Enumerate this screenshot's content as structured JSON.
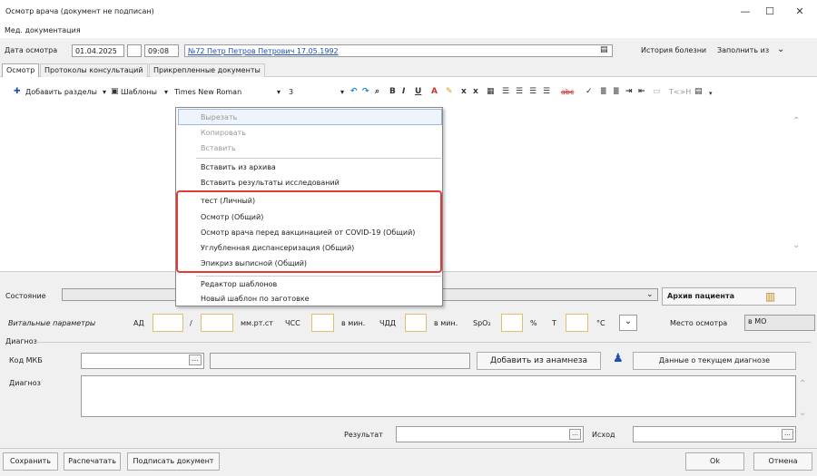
{
  "window": {
    "title": "Осмотр врача (документ не подписан)",
    "min": "—",
    "max": "☐",
    "close": "✕"
  },
  "menu_label": "Мед. документация",
  "header": {
    "date_label": "Дата осмотра",
    "date": "01.04.2025",
    "time": "09:08",
    "patient_link": "№72 Петр Петров Петрович 17.05.1992",
    "history_btn": "История болезни",
    "fill_from": "Заполнить из",
    "fill_arrow": "⌄"
  },
  "tabs": [
    "Осмотр",
    "Протоколы консультаций",
    "Прикрепленные документы"
  ],
  "toolbar": {
    "add_sections": "Добавить разделы",
    "templates": "Шаблоны",
    "font": "Times New Roman",
    "size": "3",
    "dropdown": "▾",
    "bold": "B",
    "italic": "I",
    "underline": "U",
    "sub": "x",
    "sup": "x",
    "strike": "abc",
    "tag": "T<>H"
  },
  "context_menu": {
    "items_top": [
      "Вырезать",
      "Копировать",
      "Вставить"
    ],
    "items_insert": [
      "Вставить из архива",
      "Вставить результаты исследований"
    ],
    "templates": [
      "тест (Личный)",
      "Осмотр (Общий)",
      "Осмотр врача перед вакцинацией от COVID-19 (Общий)",
      "Углубленная диспансеризация (Общий)",
      "Эпикриз выписной (Общий)"
    ],
    "items_bottom": [
      "Редактор шаблонов",
      "Новый шаблон по заготовке"
    ]
  },
  "state": {
    "label": "Состояние",
    "archive_btn": "Архив пациента"
  },
  "vitals": {
    "label": "Витальные параметры",
    "ad": "АД",
    "slash": "/",
    "mmhg": "мм.рт.ст",
    "chss": "ЧСС",
    "per_min": "в мин.",
    "chdd": "ЧДД",
    "per_min2": "в мин.",
    "spo2": "SpO₂",
    "percent": "%",
    "t": "T",
    "celsius": "°C",
    "place_label": "Место осмотра",
    "place_value": "в МО"
  },
  "diagnosis": {
    "group": "Диагноз",
    "mkb_label": "Код МКБ",
    "add_anamnesis": "Добавить из анамнеза",
    "current_diag": "Данные о текущем диагнозе",
    "diag_label": "Диагноз"
  },
  "result": {
    "result_label": "Результат",
    "outcome_label": "Исход"
  },
  "footer": {
    "save": "Сохранить",
    "print": "Распечатать",
    "sign": "Подписать документ",
    "ok": "Ok",
    "cancel": "Отмена"
  },
  "colors": {
    "accent": "#1a4fb5",
    "highlight": "#e53935"
  },
  "icons": [
    "plus-icon",
    "template-icon",
    "undo-icon",
    "redo-icon",
    "search-icon",
    "color-icon",
    "archive-icon",
    "user-icon"
  ]
}
